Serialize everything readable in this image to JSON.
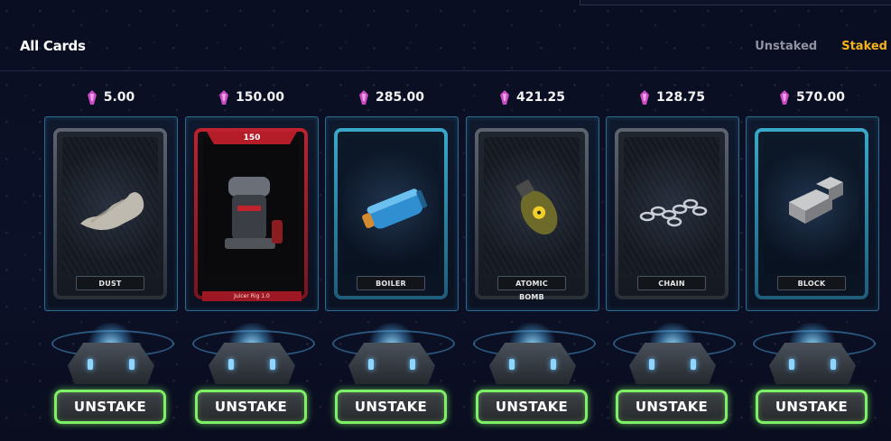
{
  "header": {
    "title": "All Cards"
  },
  "tabs": [
    {
      "label": "Unstaked",
      "active": false
    },
    {
      "label": "Staked",
      "active": true
    }
  ],
  "cards": [
    {
      "price": "5.00",
      "name": "DUST",
      "icon": "dust-icon"
    },
    {
      "price": "150.00",
      "name": "Juicer Rig 1.0",
      "badge": "150",
      "icon": "juicer-rig-icon"
    },
    {
      "price": "285.00",
      "name": "BOILER",
      "icon": "boiler-icon"
    },
    {
      "price": "421.25",
      "name": "ATOMIC BOMB",
      "icon": "atomic-bomb-icon"
    },
    {
      "price": "128.75",
      "name": "CHAIN",
      "icon": "chain-icon"
    },
    {
      "price": "570.00",
      "name": "BLOCK",
      "icon": "block-icon"
    }
  ],
  "actions": {
    "unstake_label": "UNSTAKE"
  },
  "colors": {
    "accent": "#f5b21a",
    "button_glow": "#7ef065",
    "gem": "#c94cc2"
  }
}
